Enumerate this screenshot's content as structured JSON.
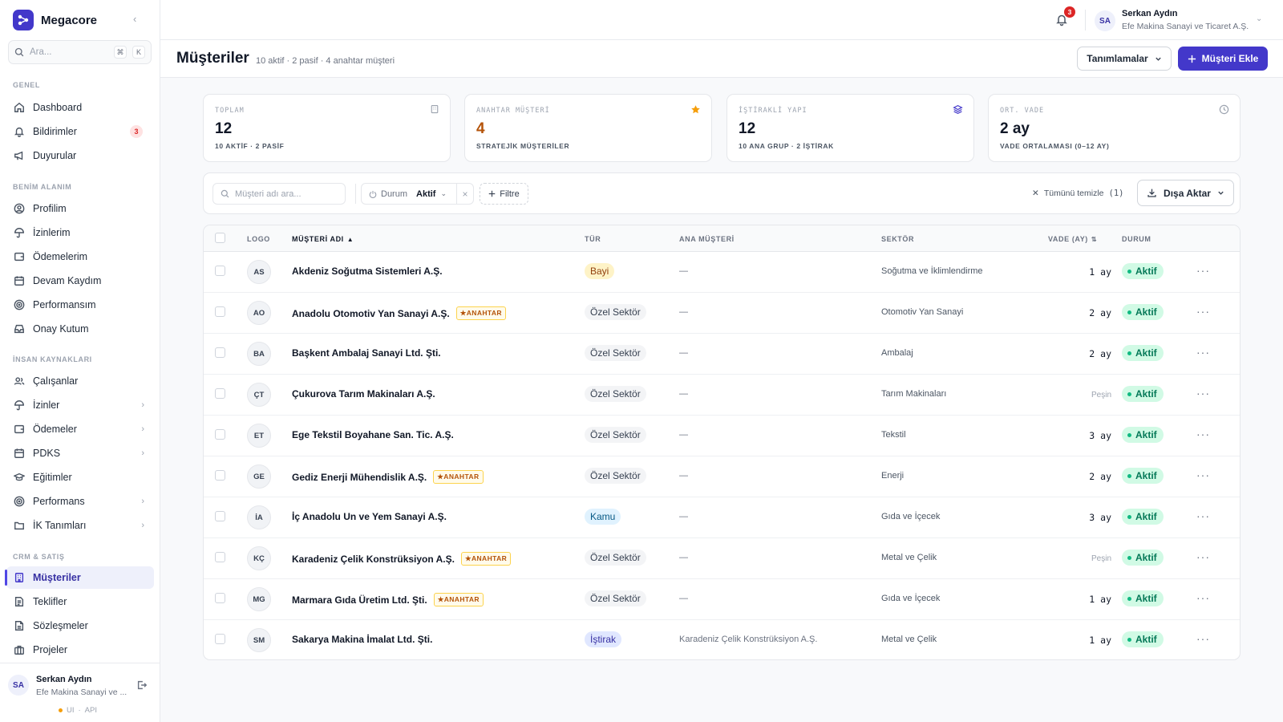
{
  "app": {
    "name": "Megacore"
  },
  "sidebar": {
    "search_placeholder": "Ara...",
    "search_kbd": [
      "⌘",
      "K"
    ],
    "sections": {
      "genel": "GENEL",
      "benim": "BENİM ALANIM",
      "ik": "İNSAN KAYNAKLARI",
      "crm": "CRM & SATIŞ"
    },
    "items": {
      "dashboard": "Dashboard",
      "bildirimler": "Bildirimler",
      "bildirimler_badge": "3",
      "duyurular": "Duyurular",
      "profilim": "Profilim",
      "izinlerim": "İzinlerim",
      "odemelerim": "Ödemelerim",
      "devam": "Devam Kaydım",
      "performansim": "Performansım",
      "onay": "Onay Kutum",
      "calisanlar": "Çalışanlar",
      "izinler": "İzinler",
      "odemeler": "Ödemeler",
      "pdks": "PDKS",
      "egitimler": "Eğitimler",
      "performans": "Performans",
      "ik_tanimlari": "İK Tanımları",
      "musteriler": "Müşteriler",
      "teklifler": "Teklifler",
      "sozlesmeler": "Sözleşmeler",
      "projeler": "Projeler"
    },
    "user": {
      "initials": "SA",
      "name": "Serkan Aydın",
      "company": "Efe Makina Sanayi ve ...",
      "status_ui": "UI",
      "status_sep": "·",
      "status_api": "API"
    }
  },
  "topbar": {
    "notif_count": "3",
    "user": {
      "initials": "SA",
      "name": "Serkan Aydın",
      "company": "Efe Makina Sanayi ve Ticaret A.Ş."
    }
  },
  "header": {
    "title": "Müşteriler",
    "subtitle": "10 aktif · 2 pasif · 4 anahtar müşteri",
    "definitions_label": "Tanımlamalar",
    "add_label": "Müşteri Ekle"
  },
  "stats": [
    {
      "label": "TOPLAM",
      "value": "12",
      "sub": "10 AKTİF · 2 PASİF",
      "icon": "building-icon",
      "value_color": "#111827"
    },
    {
      "label": "ANAHTAR MÜŞTERİ",
      "value": "4",
      "sub": "STRATEJİK MÜŞTERİLER",
      "icon": "star-icon",
      "value_color": "#b45309"
    },
    {
      "label": "İŞTİRAKLİ YAPI",
      "value": "12",
      "sub": "10 ANA GRUP · 2 İŞTİRAK",
      "icon": "layers-icon",
      "value_color": "#111827"
    },
    {
      "label": "ORT. VADE",
      "value": "2 ay",
      "sub": "VADE ORTALAMASI (0–12 AY)",
      "icon": "clock-icon",
      "value_color": "#111827"
    }
  ],
  "filters": {
    "search_placeholder": "Müşteri adı ara...",
    "chip_key": "Durum",
    "chip_value": "Aktif",
    "add_filter": "Filtre",
    "clear_label": "Tümünü temizle",
    "clear_count": "(1)",
    "export_label": "Dışa Aktar"
  },
  "table": {
    "columns": [
      "LOGO",
      "MÜŞTERİ ADI",
      "TÜR",
      "ANA MÜŞTERİ",
      "SEKTÖR",
      "VADE (AY)",
      "DURUM"
    ],
    "key_tag": "ANAHTAR",
    "rows": [
      {
        "initials": "AS",
        "name": "Akdeniz Soğutma Sistemleri A.Ş.",
        "key": false,
        "type": "Bayi",
        "type_class": "bayi",
        "parent": "—",
        "sector": "Soğutma ve İklimlendirme",
        "term": "1 ay",
        "term_muted": false,
        "status": "Aktif"
      },
      {
        "initials": "AO",
        "name": "Anadolu Otomotiv Yan Sanayi A.Ş.",
        "key": true,
        "type": "Özel Sektör",
        "type_class": "ozel",
        "parent": "—",
        "sector": "Otomotiv Yan Sanayi",
        "term": "2 ay",
        "term_muted": false,
        "status": "Aktif"
      },
      {
        "initials": "BA",
        "name": "Başkent Ambalaj Sanayi Ltd. Şti.",
        "key": false,
        "type": "Özel Sektör",
        "type_class": "ozel",
        "parent": "—",
        "sector": "Ambalaj",
        "term": "2 ay",
        "term_muted": false,
        "status": "Aktif"
      },
      {
        "initials": "ÇT",
        "name": "Çukurova Tarım Makinaları A.Ş.",
        "key": false,
        "type": "Özel Sektör",
        "type_class": "ozel",
        "parent": "—",
        "sector": "Tarım Makinaları",
        "term": "Peşin",
        "term_muted": true,
        "status": "Aktif"
      },
      {
        "initials": "ET",
        "name": "Ege Tekstil Boyahane San. Tic. A.Ş.",
        "key": false,
        "type": "Özel Sektör",
        "type_class": "ozel",
        "parent": "—",
        "sector": "Tekstil",
        "term": "3 ay",
        "term_muted": false,
        "status": "Aktif"
      },
      {
        "initials": "GE",
        "name": "Gediz Enerji Mühendislik A.Ş.",
        "key": true,
        "type": "Özel Sektör",
        "type_class": "ozel",
        "parent": "—",
        "sector": "Enerji",
        "term": "2 ay",
        "term_muted": false,
        "status": "Aktif"
      },
      {
        "initials": "İA",
        "name": "İç Anadolu Un ve Yem Sanayi A.Ş.",
        "key": false,
        "type": "Kamu",
        "type_class": "kamu",
        "parent": "—",
        "sector": "Gıda ve İçecek",
        "term": "3 ay",
        "term_muted": false,
        "status": "Aktif"
      },
      {
        "initials": "KÇ",
        "name": "Karadeniz Çelik Konstrüksiyon A.Ş.",
        "key": true,
        "type": "Özel Sektör",
        "type_class": "ozel",
        "parent": "—",
        "sector": "Metal ve Çelik",
        "term": "Peşin",
        "term_muted": true,
        "status": "Aktif"
      },
      {
        "initials": "MG",
        "name": "Marmara Gıda Üretim Ltd. Şti.",
        "key": true,
        "type": "Özel Sektör",
        "type_class": "ozel",
        "parent": "—",
        "sector": "Gıda ve İçecek",
        "term": "1 ay",
        "term_muted": false,
        "status": "Aktif"
      },
      {
        "initials": "SM",
        "name": "Sakarya Makina İmalat Ltd. Şti.",
        "key": false,
        "type": "İştirak",
        "type_class": "istirak",
        "parent": "Karadeniz Çelik Konstrüksiyon A.Ş.",
        "sector": "Metal ve Çelik",
        "term": "1 ay",
        "term_muted": false,
        "status": "Aktif"
      }
    ]
  }
}
